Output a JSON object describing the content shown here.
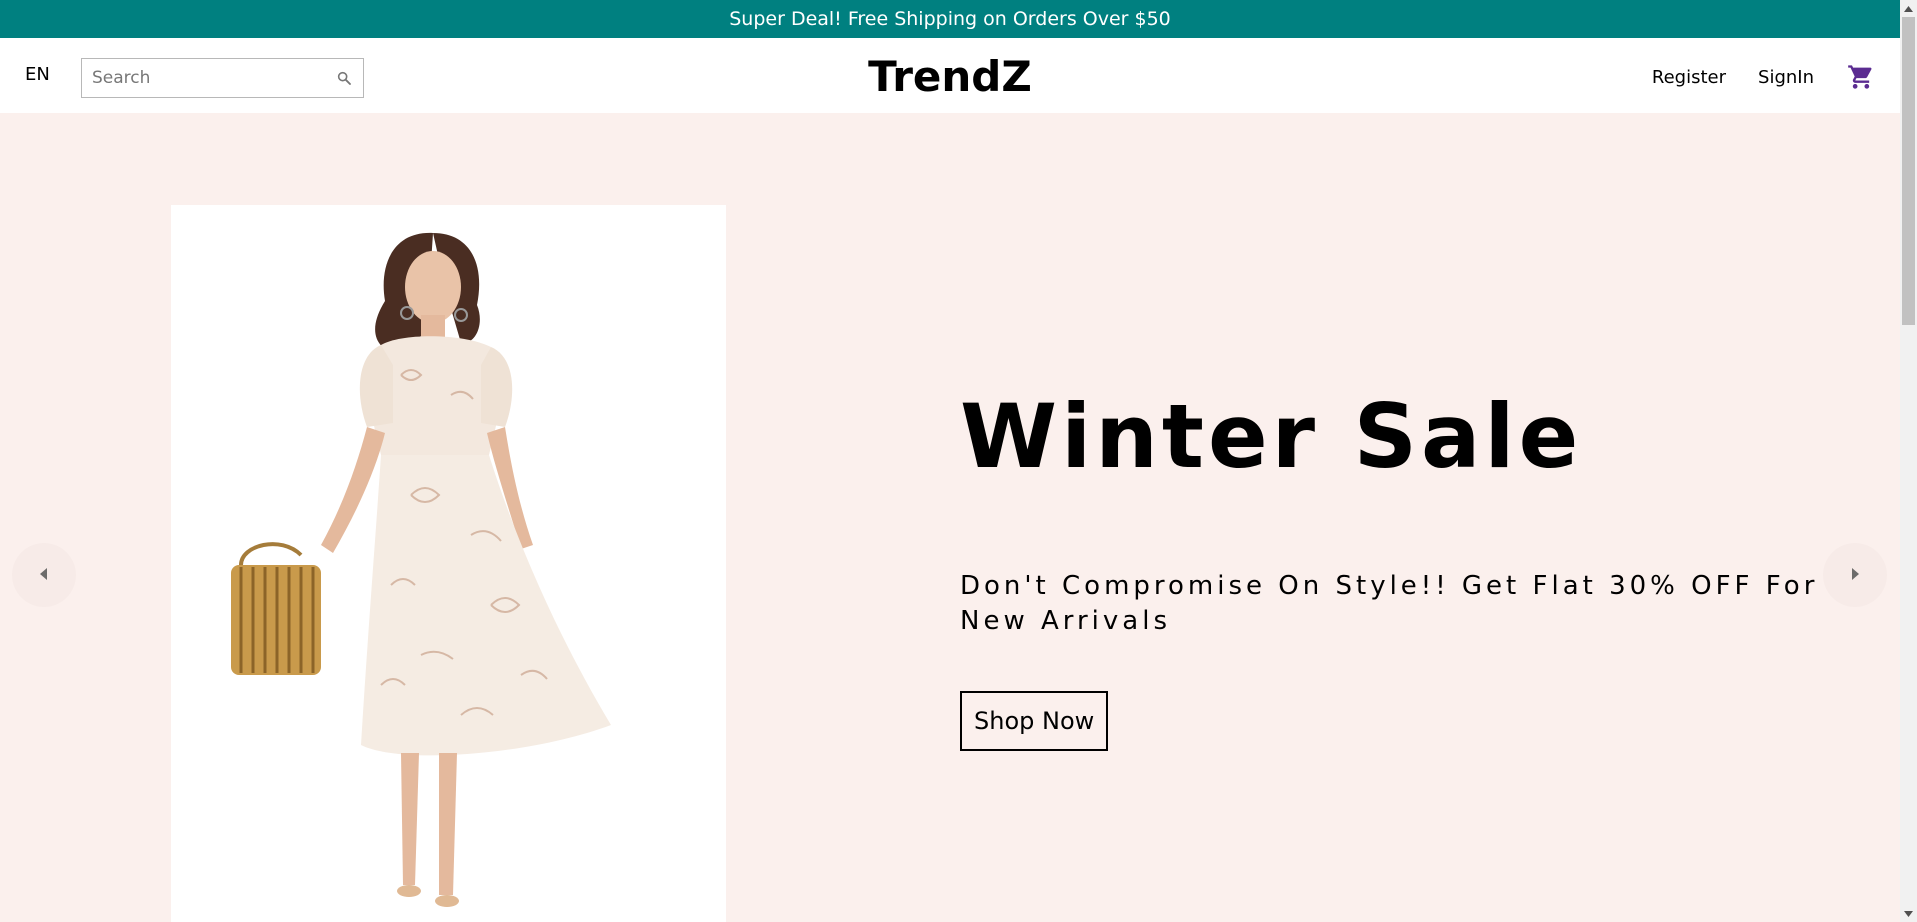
{
  "announcement": {
    "text": "Super Deal! Free Shipping on Orders Over $50",
    "background": "#008080"
  },
  "navbar": {
    "language": "EN",
    "search": {
      "placeholder": "Search",
      "value": "",
      "icon": "search-icon"
    },
    "logo": "TrendZ",
    "links": {
      "register": "Register",
      "signin": "SignIn"
    },
    "cart_icon": "shopping-cart-icon",
    "cart_icon_color": "#5b2c91"
  },
  "hero": {
    "background": "#fbf0ed",
    "title": "Winter Sale",
    "description": "Don't Compromise On Style!! Get Flat 30% OFF For New Arrivals",
    "button_label": "Shop Now",
    "image_alt": "woman-in-floral-dress-with-bamboo-bag",
    "prev_icon": "arrow-left-icon",
    "next_icon": "arrow-right-icon"
  }
}
